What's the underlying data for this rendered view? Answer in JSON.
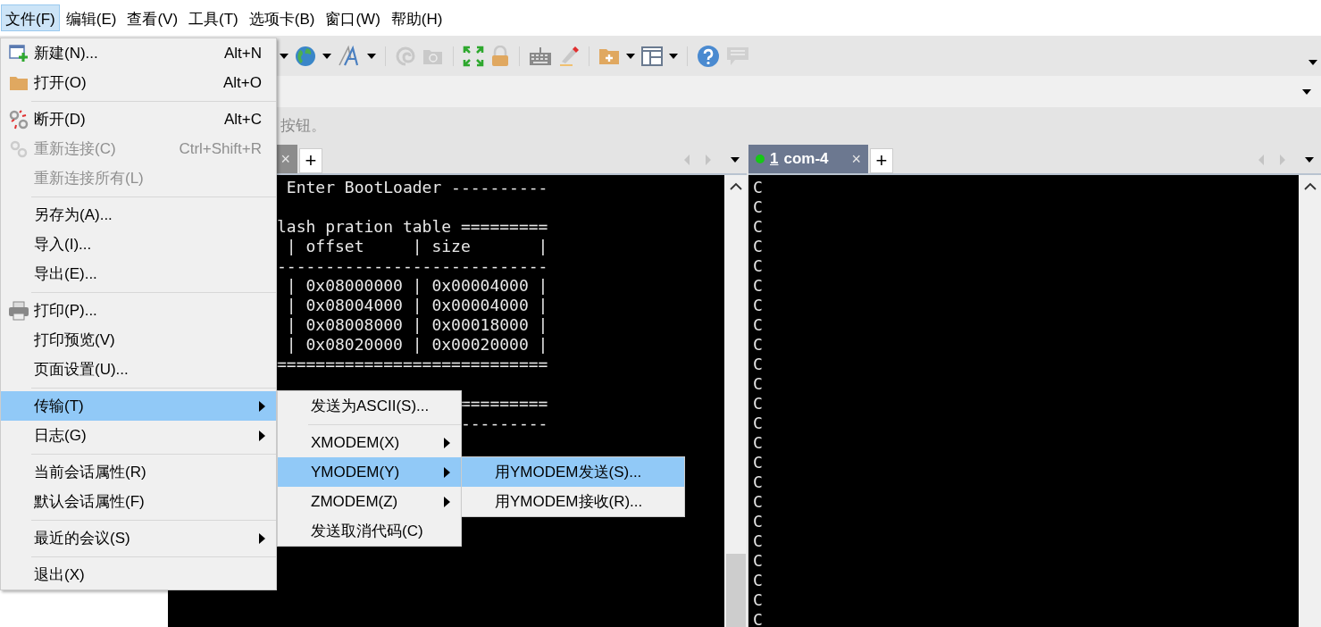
{
  "menubar": [
    {
      "label": "文件(F)",
      "selected": true
    },
    {
      "label": "编辑(E)",
      "selected": false
    },
    {
      "label": "查看(V)",
      "selected": false
    },
    {
      "label": "工具(T)",
      "selected": false
    },
    {
      "label": "选项卡(B)",
      "selected": false
    },
    {
      "label": "窗口(W)",
      "selected": false
    },
    {
      "label": "帮助(H)",
      "selected": false
    }
  ],
  "hint": "按钮。",
  "file_menu": [
    {
      "kind": "item",
      "label": "新建(N)...",
      "shortcut": "Alt+N",
      "disabled": false,
      "selected": false,
      "submenu": false
    },
    {
      "kind": "item",
      "label": "打开(O)",
      "shortcut": "Alt+O",
      "disabled": false,
      "selected": false,
      "submenu": false
    },
    {
      "kind": "separator"
    },
    {
      "kind": "item",
      "label": "断开(D)",
      "shortcut": "Alt+C",
      "disabled": false,
      "selected": false,
      "submenu": false
    },
    {
      "kind": "item",
      "label": "重新连接(C)",
      "shortcut": "Ctrl+Shift+R",
      "disabled": true,
      "selected": false,
      "submenu": false
    },
    {
      "kind": "item",
      "label": "重新连接所有(L)",
      "disabled": true,
      "selected": false,
      "submenu": false
    },
    {
      "kind": "separator"
    },
    {
      "kind": "item",
      "label": "另存为(A)...",
      "disabled": false,
      "selected": false,
      "submenu": false
    },
    {
      "kind": "item",
      "label": "导入(I)...",
      "disabled": false,
      "selected": false,
      "submenu": false
    },
    {
      "kind": "item",
      "label": "导出(E)...",
      "disabled": false,
      "selected": false,
      "submenu": false
    },
    {
      "kind": "separator"
    },
    {
      "kind": "item",
      "label": "打印(P)...",
      "disabled": false,
      "selected": false,
      "submenu": false
    },
    {
      "kind": "item",
      "label": "打印预览(V)",
      "disabled": false,
      "selected": false,
      "submenu": false
    },
    {
      "kind": "item",
      "label": "页面设置(U)...",
      "disabled": false,
      "selected": false,
      "submenu": false
    },
    {
      "kind": "separator"
    },
    {
      "kind": "item",
      "label": "传输(T)",
      "disabled": false,
      "selected": true,
      "submenu": true
    },
    {
      "kind": "item",
      "label": "日志(G)",
      "disabled": false,
      "selected": false,
      "submenu": true
    },
    {
      "kind": "separator"
    },
    {
      "kind": "item",
      "label": "当前会话属性(R)",
      "disabled": false,
      "selected": false,
      "submenu": false
    },
    {
      "kind": "item",
      "label": "默认会话属性(F)",
      "disabled": false,
      "selected": false,
      "submenu": false
    },
    {
      "kind": "separator"
    },
    {
      "kind": "item",
      "label": "最近的会议(S)",
      "disabled": false,
      "selected": false,
      "submenu": true
    },
    {
      "kind": "separator"
    },
    {
      "kind": "item",
      "label": "退出(X)",
      "disabled": false,
      "selected": false,
      "submenu": false
    }
  ],
  "transfer_menu": [
    {
      "kind": "item",
      "label": "发送为ASCII(S)...",
      "disabled": false,
      "selected": false,
      "submenu": false
    },
    {
      "kind": "separator"
    },
    {
      "kind": "item",
      "label": "XMODEM(X)",
      "disabled": false,
      "selected": false,
      "submenu": true
    },
    {
      "kind": "item",
      "label": "YMODEM(Y)",
      "disabled": false,
      "selected": true,
      "submenu": true
    },
    {
      "kind": "item",
      "label": "ZMODEM(Z)",
      "disabled": false,
      "selected": false,
      "submenu": true
    },
    {
      "kind": "item",
      "label": "发送取消代码(C)",
      "disabled": false,
      "selected": false,
      "submenu": false
    }
  ],
  "ymodem_menu": [
    {
      "kind": "item",
      "label": "用YMODEM发送(S)...",
      "disabled": false,
      "selected": true,
      "submenu": false
    },
    {
      "kind": "item",
      "label": "用YMODEM接收(R)...",
      "disabled": false,
      "selected": false,
      "submenu": false
    }
  ],
  "left_pane": {
    "tab": {
      "close": "×",
      "focused": false
    },
    "new_tab": "+",
    "blocks": [
      [
        " Enter BootLoader ----------"
      ],
      [
        "lash pration table =========",
        " | offset     | size       |",
        "----------------------------",
        " | 0x08000000 | 0x00004000 |",
        " | 0x08004000 | 0x00004000 |",
        " | 0x08008000 | 0x00018000 |",
        " | 0x08020000 | 0x00020000 |",
        "============================"
      ],
      [
        "                   =========",
        "                   ---------"
      ]
    ]
  },
  "right_pane": {
    "tab": {
      "number": "1",
      "label": "com-4",
      "connected": true,
      "close": "×",
      "focused": true
    },
    "new_tab": "+",
    "lines": [
      "C",
      "C",
      "C",
      "C",
      "C",
      "C",
      "C",
      "C",
      "C",
      "C",
      "C",
      "C",
      "C",
      "C",
      "C",
      "C",
      "C",
      "C",
      "C",
      "C",
      "C",
      "C",
      "C"
    ]
  }
}
